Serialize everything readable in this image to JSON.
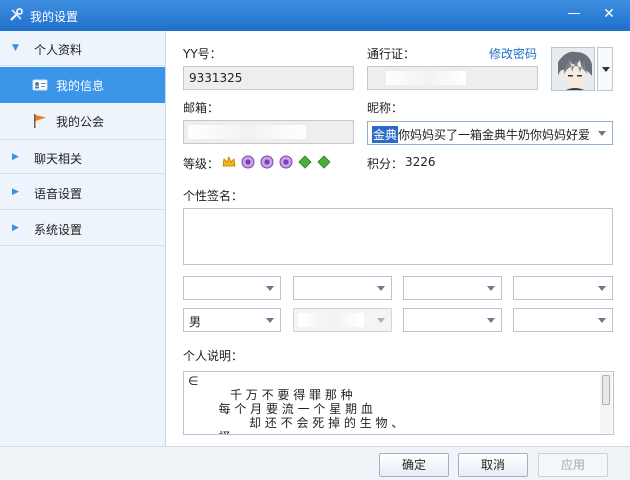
{
  "window": {
    "title": "我的设置",
    "minimize": "—",
    "close": "✕"
  },
  "sidebar": {
    "sections": [
      {
        "label": "个人资料",
        "expanded": true,
        "icon": "triangle-down-icon"
      },
      {
        "label": "聊天相关",
        "expanded": false,
        "icon": "triangle-right-icon"
      },
      {
        "label": "语音设置",
        "expanded": false,
        "icon": "triangle-right-icon"
      },
      {
        "label": "系统设置",
        "expanded": false,
        "icon": "triangle-right-icon"
      }
    ],
    "sub_items": [
      {
        "label": "我的信息",
        "active": true,
        "icon": "id-card-icon"
      },
      {
        "label": "我的公会",
        "active": false,
        "icon": "flag-icon"
      }
    ]
  },
  "profile": {
    "yy_label": "YY号：",
    "yy_value": "9331325",
    "passport_label": "通行证：",
    "change_password": "修改密码",
    "email_label": "邮箱：",
    "nickname_label": "昵称：",
    "nickname_highlight": "金典",
    "nickname_rest": "你妈妈买了一箱金典牛奶你妈妈好爱",
    "level_label": "等级：",
    "points_label": "积分：",
    "points_value": "3226",
    "signature_label": "个性签名：",
    "gender_value": "男",
    "description_label": "个人说明：",
    "description_text": "∈\n           千 万 不 要 得 罪 那 种\n        每 个 月 要 流 一 个 星 期 血\n                却 还 不 会 死 掉 的 生 物 、\n        怪"
  },
  "buttons": {
    "ok": "确定",
    "cancel": "取消",
    "apply": "应用"
  },
  "colors": {
    "titlebar": "#2a7bd6",
    "active_nav": "#3b95e8",
    "link": "#1f6fcc"
  }
}
